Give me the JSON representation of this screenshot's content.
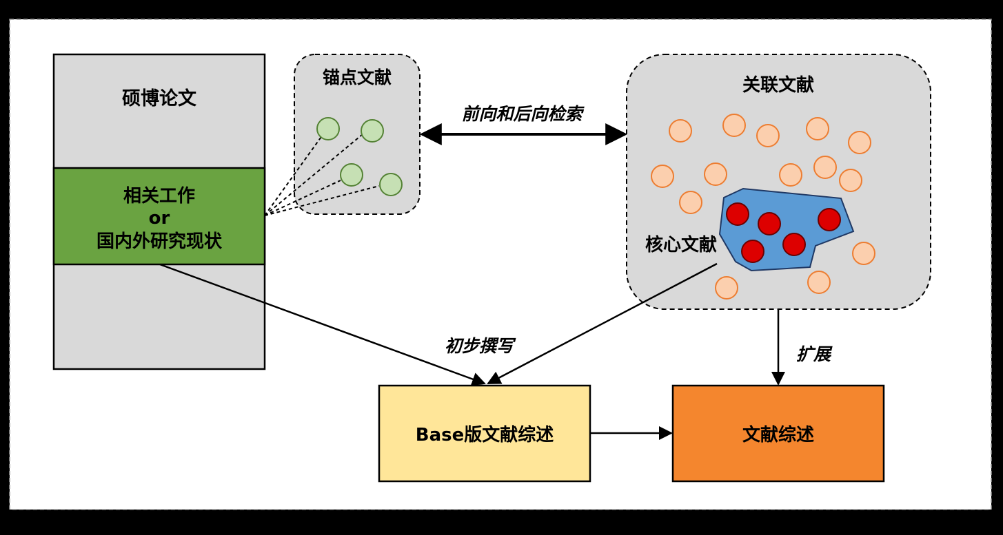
{
  "thesis": {
    "title": "硕博论文",
    "related_line1": "相关工作",
    "related_line2": "or",
    "related_line3": "国内外研究现状"
  },
  "anchor": {
    "title": "锚点文献"
  },
  "related_docs": {
    "title": "关联文献"
  },
  "core": {
    "label": "核心文献"
  },
  "edges": {
    "search": "前向和后向检索",
    "draft": "初步撰写",
    "expand": "扩展"
  },
  "base_review": {
    "label": "Base版文献综述"
  },
  "final_review": {
    "label": "文献综述"
  },
  "colors": {
    "thesis_gray": "#d9d9d9",
    "related_green": "#6aa341",
    "anchor_node": "#c6e0b4",
    "related_node": "#fbcfae",
    "core_region": "#5b9bd5",
    "core_node": "#dd0000",
    "base_fill": "#ffe699",
    "final_fill": "#f4862e"
  }
}
